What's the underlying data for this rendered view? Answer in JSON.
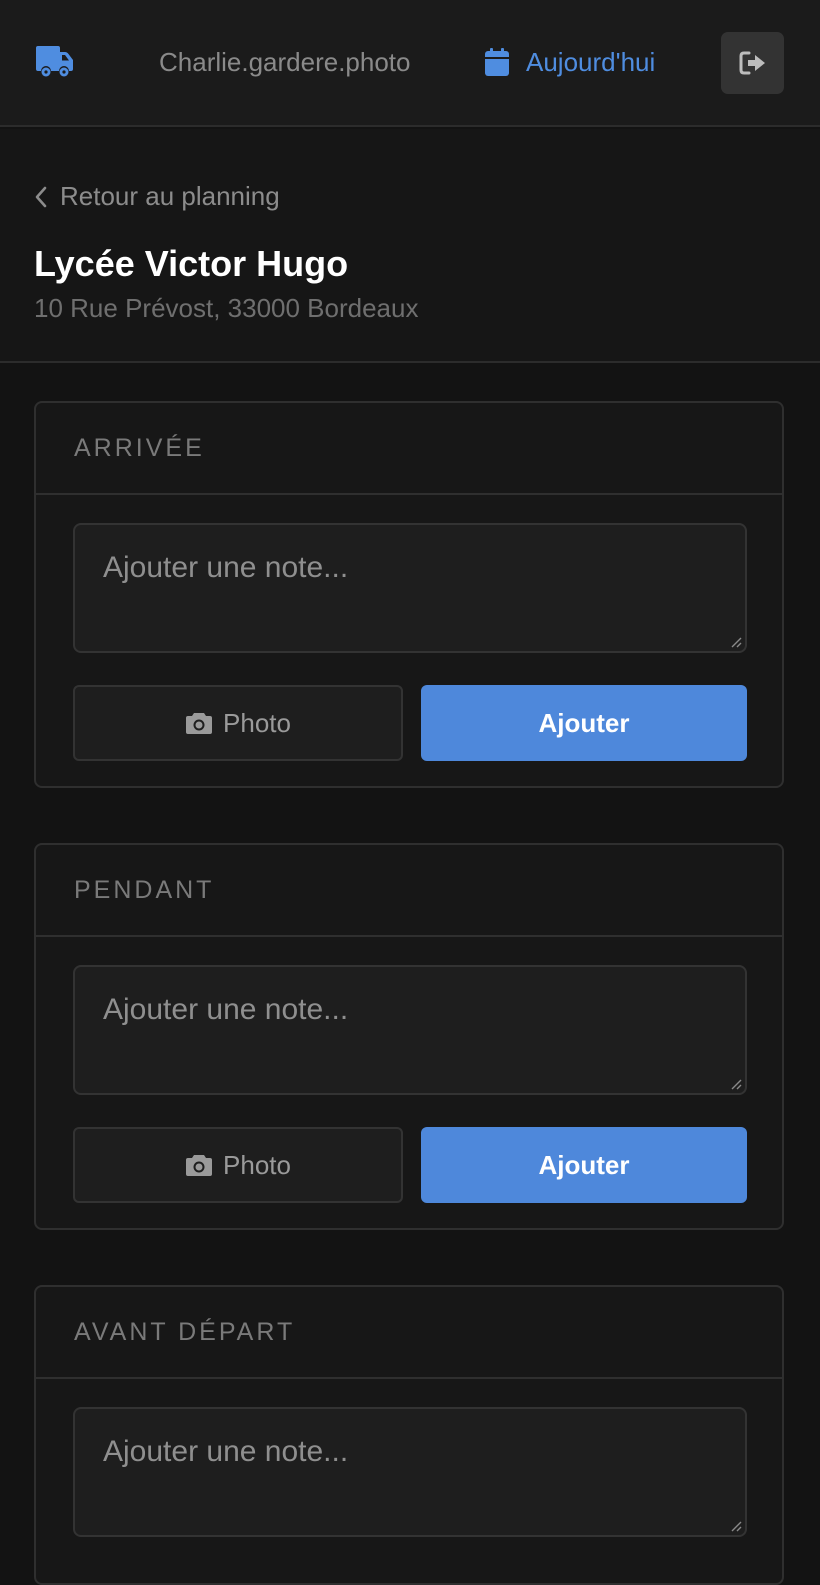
{
  "header": {
    "user": "Charlie.gardere.photo",
    "today_label": "Aujourd'hui",
    "accent_color": "#4f8de0",
    "icons": [
      "truck-icon",
      "calendar-icon",
      "logout-icon"
    ]
  },
  "nav": {
    "back_label": "Retour au planning"
  },
  "venue": {
    "name": "Lycée Victor Hugo",
    "address": "10 Rue Prévost, 33000 Bordeaux"
  },
  "sections": [
    {
      "title": "ARRIVÉE",
      "note_placeholder": "Ajouter une note...",
      "photo_label": "Photo",
      "add_label": "Ajouter"
    },
    {
      "title": "PENDANT",
      "note_placeholder": "Ajouter une note...",
      "photo_label": "Photo",
      "add_label": "Ajouter"
    },
    {
      "title": "AVANT DÉPART",
      "note_placeholder": "Ajouter une note..."
    }
  ],
  "colors": {
    "primary_button": "#4e88db",
    "background": "#131313"
  }
}
